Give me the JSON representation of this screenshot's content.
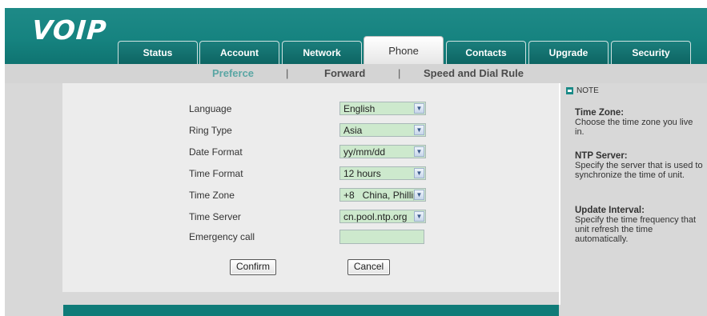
{
  "header": {
    "logo": "VOIP",
    "tabs": [
      {
        "label": "Status",
        "active": false
      },
      {
        "label": "Account",
        "active": false
      },
      {
        "label": "Network",
        "active": false
      },
      {
        "label": "Phone",
        "active": true
      },
      {
        "label": "Contacts",
        "active": false
      },
      {
        "label": "Upgrade",
        "active": false
      },
      {
        "label": "Security",
        "active": false
      }
    ]
  },
  "subnav": {
    "items": [
      "Preferce",
      "Forward",
      "Speed and Dial Rule"
    ],
    "separator": "|",
    "active_index": 0
  },
  "form": {
    "fields": [
      {
        "label": "Language",
        "value": "English"
      },
      {
        "label": "Ring Type",
        "value": "Asia"
      },
      {
        "label": "Date Format",
        "value": "yy/mm/dd"
      },
      {
        "label": "Time Format",
        "value": "12 hours"
      },
      {
        "label": "Time Zone",
        "value": "+8   China, Phillip"
      },
      {
        "label": "Time Server",
        "value": "cn.pool.ntp.org"
      },
      {
        "label": "Emergency call",
        "value": ""
      }
    ],
    "confirm_label": "Confirm",
    "cancel_label": "Cancel"
  },
  "note": {
    "heading": "NOTE",
    "items": [
      {
        "title": "Time Zone:",
        "text": "Choose the time zone you live in."
      },
      {
        "title": "NTP Server:",
        "text": "Specify the server that is used to synchronize the time of unit."
      },
      {
        "title": "Update Interval:",
        "text": "Specify the time frequency that unit refresh the time automatically."
      }
    ]
  },
  "colors": {
    "header": "#168380",
    "subnav_bg": "#d4d4d4",
    "active_subnav": "#5aa6a4",
    "field_bg": "#cde9cd",
    "footer": "#0f7b78"
  },
  "icons": {
    "dropdown": "chevron-down-icon",
    "note": "note-icon"
  }
}
